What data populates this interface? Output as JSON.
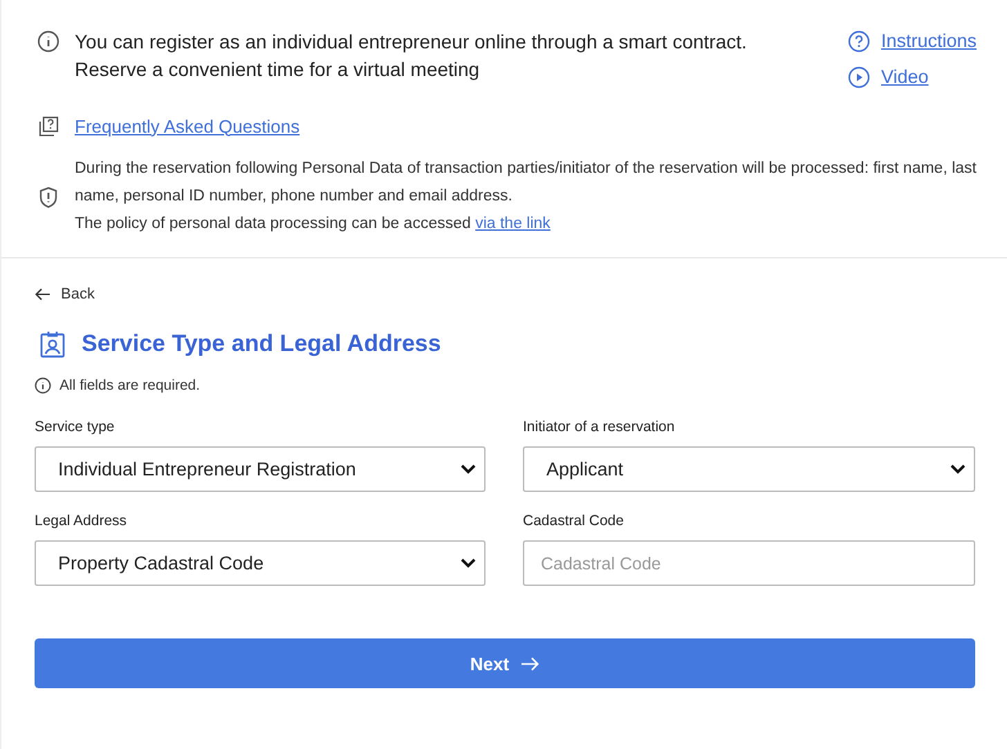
{
  "info": {
    "text": "You can register as an individual entrepreneur online through a smart contract. Reserve a convenient time for a virtual meeting"
  },
  "help_links": [
    {
      "kind": "question",
      "label": "Instructions"
    },
    {
      "kind": "play",
      "label": "Video"
    }
  ],
  "faq_link": "Frequently Asked Questions",
  "privacy": {
    "notice": "During the reservation following Personal Data of transaction parties/initiator of the reservation will be processed: first name, last name, personal ID number, phone number and email address.",
    "policy_text": "The policy of personal data processing can be accessed ",
    "policy_link": "via the link"
  },
  "back": "Back",
  "heading": "Service Type and Legal Address",
  "required_note": "All fields are required.",
  "fields": [
    {
      "kind": "select",
      "label": "Service type",
      "value": "Individual Entrepreneur Registration"
    },
    {
      "kind": "select",
      "label": "Initiator of a reservation",
      "value": "Applicant"
    },
    {
      "kind": "select",
      "label": "Legal Address",
      "value": "Property Cadastral Code"
    },
    {
      "kind": "input",
      "label": "Cadastral Code",
      "placeholder": "Cadastral Code"
    }
  ],
  "next_button": "Next"
}
